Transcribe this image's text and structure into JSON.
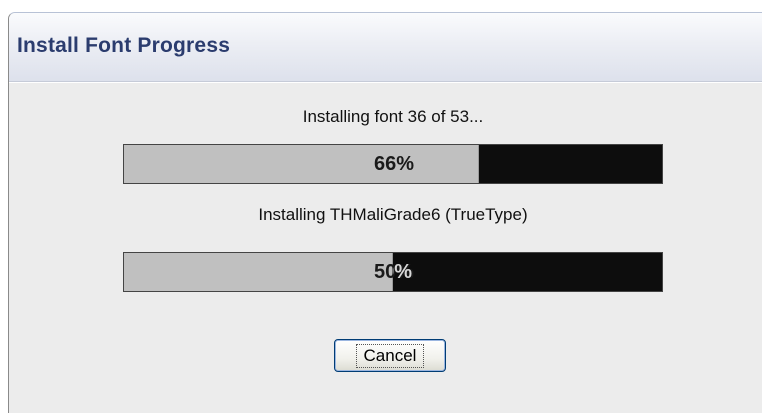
{
  "window": {
    "title": "Install Font Progress"
  },
  "overall": {
    "status_text": "Installing font 36 of 53...",
    "progress_percent": 66,
    "progress_label": "66%"
  },
  "current": {
    "status_text": "Installing THMaliGrade6 (TrueType)",
    "progress_percent": 50,
    "progress_label": "50%"
  },
  "buttons": {
    "cancel_label": "Cancel"
  },
  "colors": {
    "title_text": "#2b3c6e",
    "progress_fill": "#c0c0c0",
    "progress_track": "#0d0d0d",
    "dialog_body": "#ececec"
  }
}
